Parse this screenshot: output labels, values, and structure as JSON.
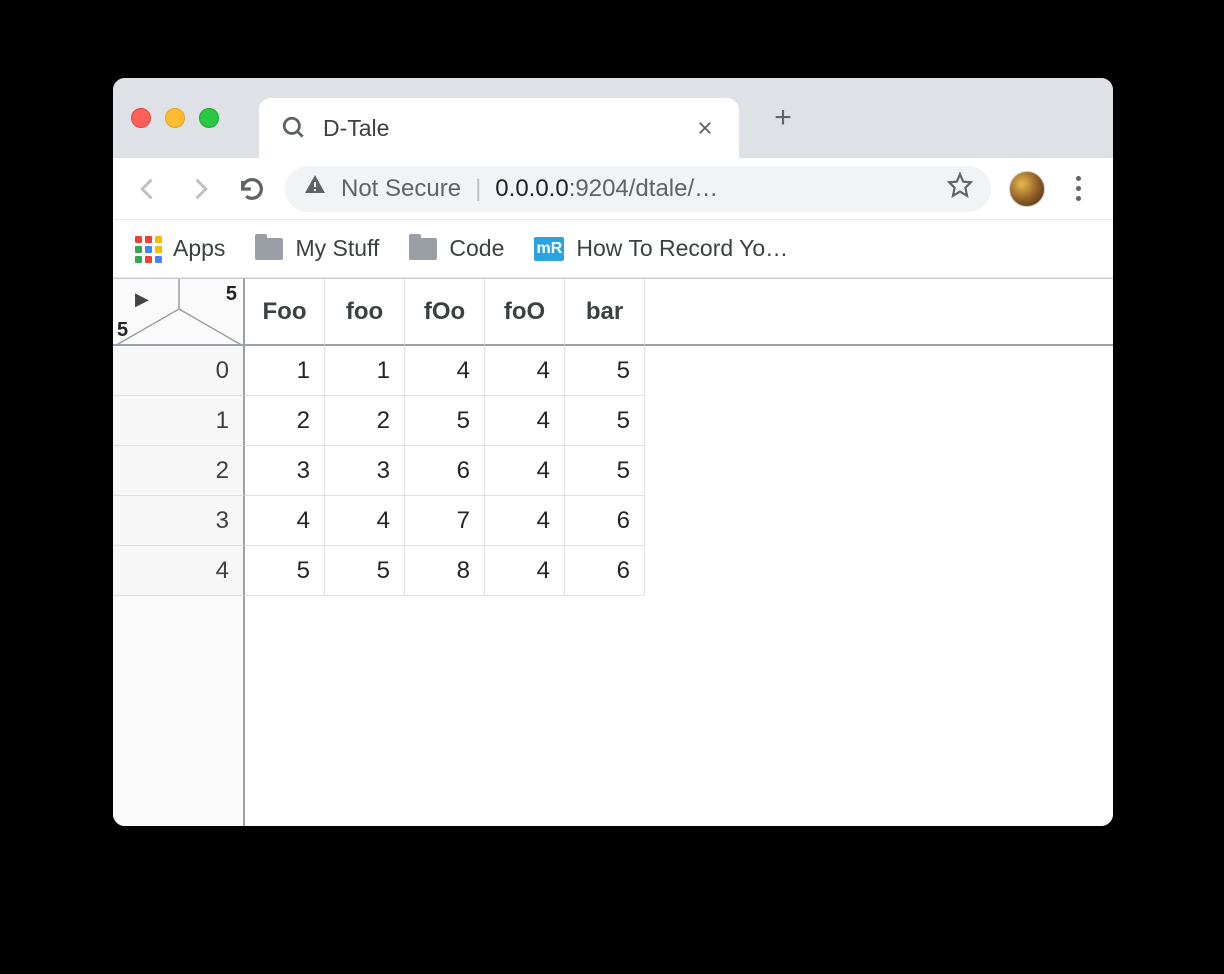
{
  "browser": {
    "tab_title": "D-Tale",
    "not_secure_label": "Not Secure",
    "url_host": "0.0.0.0",
    "url_rest": ":9204/dtale/…",
    "bookmarks": {
      "apps": "Apps",
      "my_stuff": "My Stuff",
      "code": "Code",
      "howto": "How To Record Yo…"
    }
  },
  "table": {
    "corner_top_right": "5",
    "corner_bottom_left": "5",
    "play_glyph": "▶",
    "columns": [
      "Foo",
      "foo",
      "fOo",
      "foO",
      "bar"
    ],
    "index": [
      "0",
      "1",
      "2",
      "3",
      "4"
    ],
    "rows": [
      [
        "1",
        "1",
        "4",
        "4",
        "5"
      ],
      [
        "2",
        "2",
        "5",
        "4",
        "5"
      ],
      [
        "3",
        "3",
        "6",
        "4",
        "5"
      ],
      [
        "4",
        "4",
        "7",
        "4",
        "6"
      ],
      [
        "5",
        "5",
        "8",
        "4",
        "6"
      ]
    ]
  },
  "apps_icon_colors": [
    "#ea4335",
    "#ea4335",
    "#fbbc05",
    "#34a853",
    "#4285f4",
    "#fbbc05",
    "#34a853",
    "#ea4335",
    "#4285f4"
  ]
}
